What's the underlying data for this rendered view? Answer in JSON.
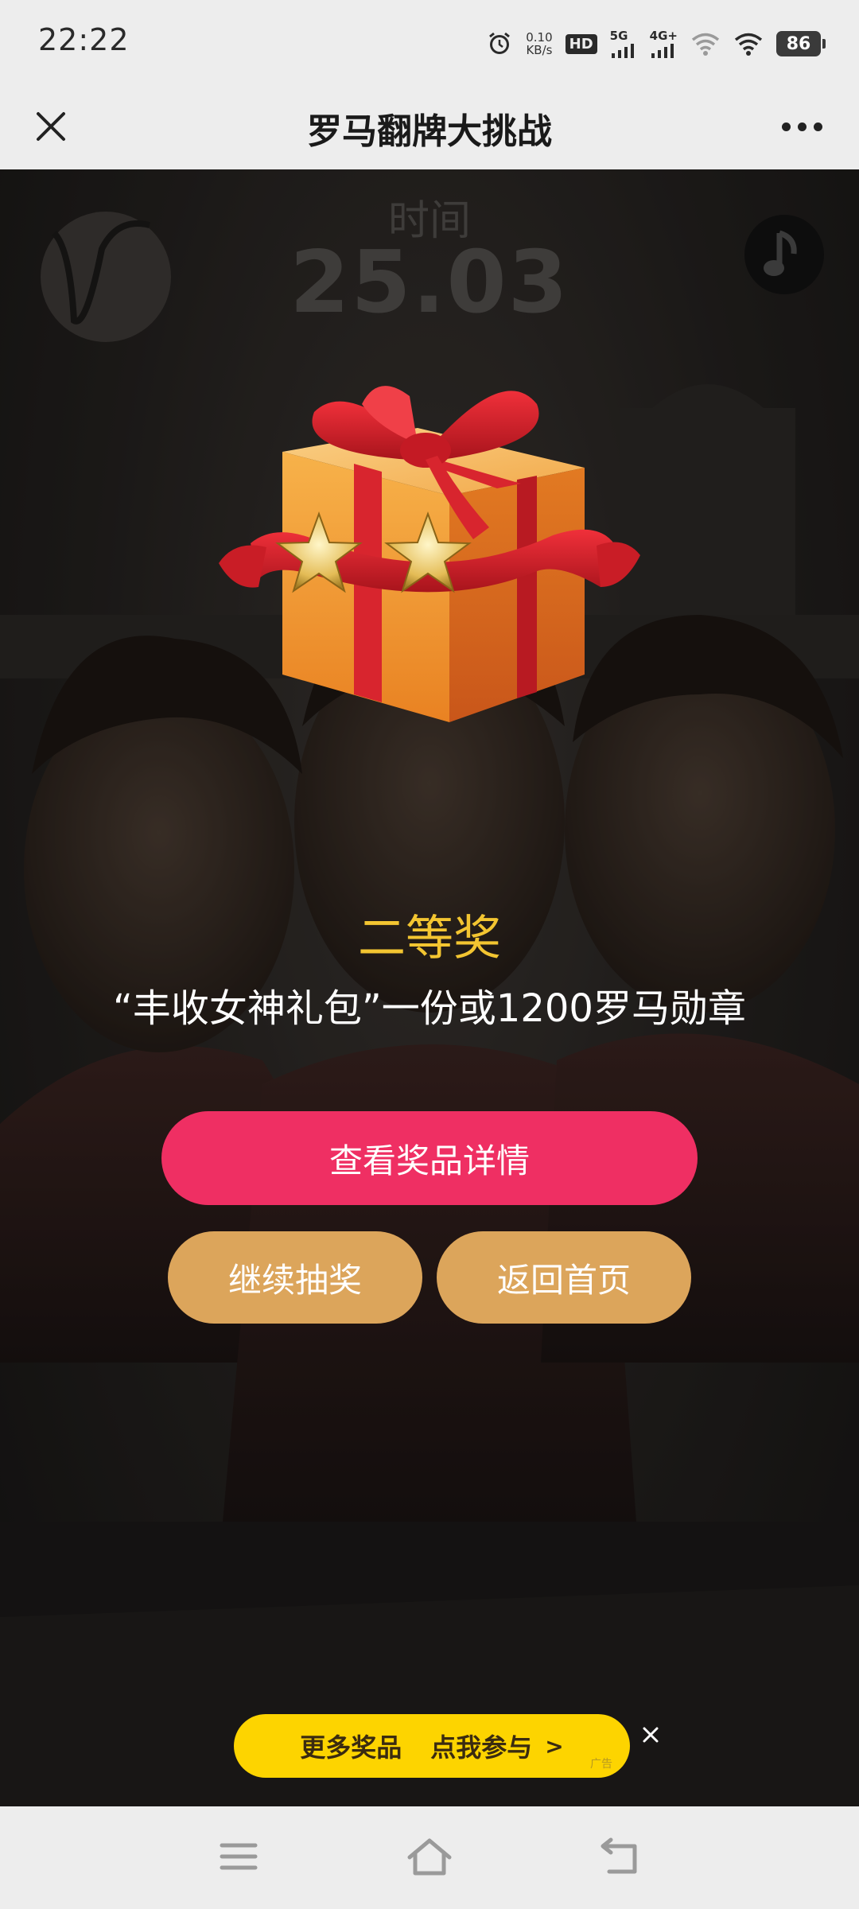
{
  "status_bar": {
    "time": "22:22",
    "net_speed_value": "0.10",
    "net_speed_unit": "KB/s",
    "hd_label": "HD",
    "net_5g": "5G",
    "net_4g": "4G+",
    "battery": "86",
    "icons": [
      "alarm-icon",
      "hd-icon",
      "signal-5g-icon",
      "signal-4g-icon",
      "wifi-icon",
      "battery-icon"
    ]
  },
  "title_bar": {
    "title": "罗马翻牌大挑战",
    "close_icon": "close-icon",
    "more_icon": "more-icon"
  },
  "game": {
    "timer_label": "时间",
    "timer_value": "25.03",
    "music_icon": "music-note-icon",
    "gift_icon": "gift-box-icon",
    "stars": 2,
    "prize_level": "二等奖",
    "prize_desc": "“丰收女神礼包”一份或1200罗马勋章",
    "btn_details": "查看奖品详情",
    "btn_continue": "继续抽奖",
    "btn_home": "返回首页",
    "ad_text_1": "更多奖品",
    "ad_text_2": "点我参与",
    "ad_chevron": ">",
    "ad_tag": "广告",
    "colors": {
      "prize_level": "#f3c531",
      "details_button": "#ef2f63",
      "secondary_button": "#dca55b",
      "ad_banner": "#fdd400"
    }
  },
  "nav_bar": {
    "icons": [
      "menu-icon",
      "home-icon",
      "back-icon"
    ]
  }
}
